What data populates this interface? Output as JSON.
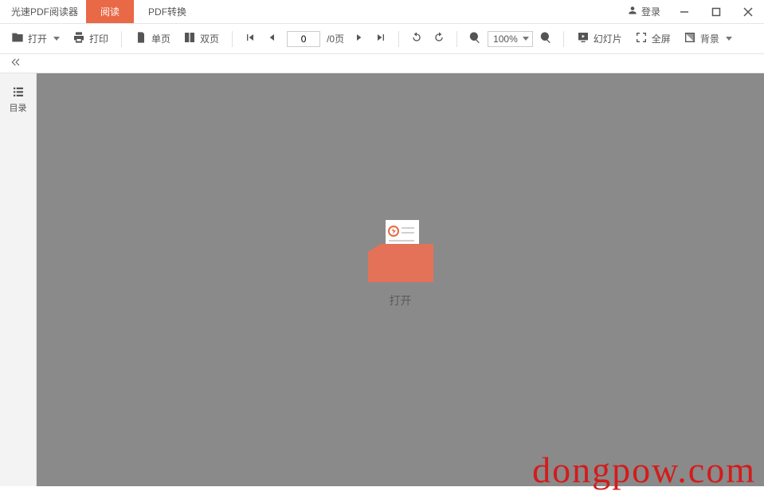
{
  "app": {
    "title": "光速PDF阅读器",
    "tabs": {
      "read": "阅读",
      "convert": "PDF转换"
    },
    "login": "登录"
  },
  "toolbar": {
    "open": "打开",
    "print": "打印",
    "single_page": "单页",
    "dual_page": "双页",
    "page_current": "0",
    "page_total": "/0页",
    "zoom_value": "100%",
    "slideshow": "幻灯片",
    "fullscreen": "全屏",
    "background": "背景"
  },
  "sidebar": {
    "toc": "目录"
  },
  "canvas": {
    "open_label": "打开"
  },
  "watermark": "dongpow.com"
}
